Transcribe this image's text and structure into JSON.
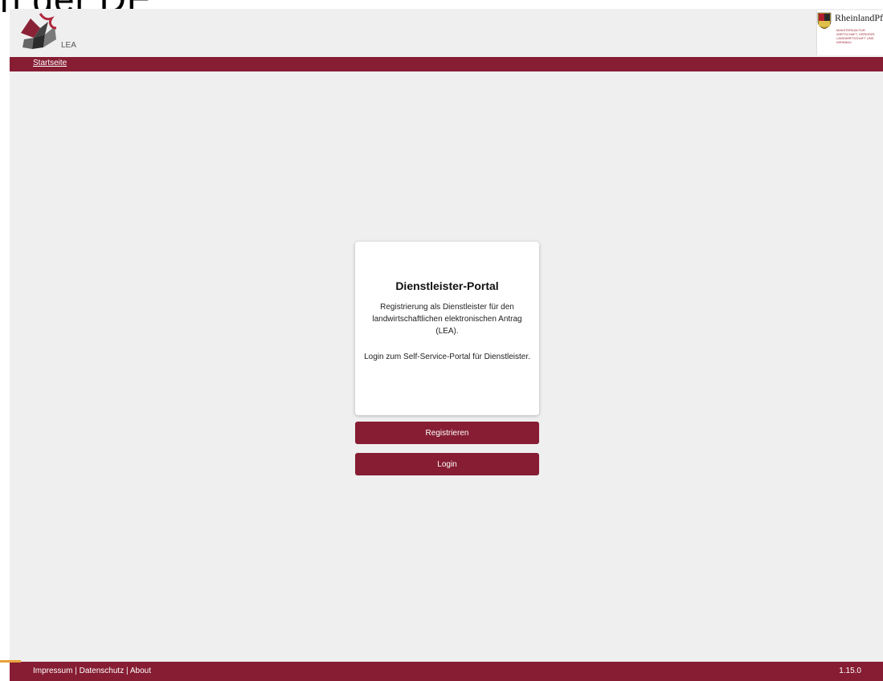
{
  "overlay_text": "n der DE",
  "header": {
    "logo_text": "LEA",
    "state_name": "RheinlandPfalz",
    "ministry_text": "MINISTERIUM FÜR WIRTSCHAFT, VERKEHR, LANDWIRTSCHAFT UND WEINBAU"
  },
  "nav": {
    "home_label": "Startseite"
  },
  "card": {
    "title": "Dienstleister-Portal",
    "description": "Registrierung als Dienstleister für den landwirtschaftlichen elektronischen Antrag (LEA).",
    "login_text": "Login zum Self-Service-Portal für Dienstleister."
  },
  "buttons": {
    "register": "Registrieren",
    "login": "Login"
  },
  "footer": {
    "impressum": "Impressum",
    "datenschutz": "Datenschutz",
    "about": "About",
    "separator": "|",
    "version": "1.15.0"
  },
  "colors": {
    "brand": "#861d33",
    "background": "#efefef",
    "accent": "#e8a23a"
  }
}
